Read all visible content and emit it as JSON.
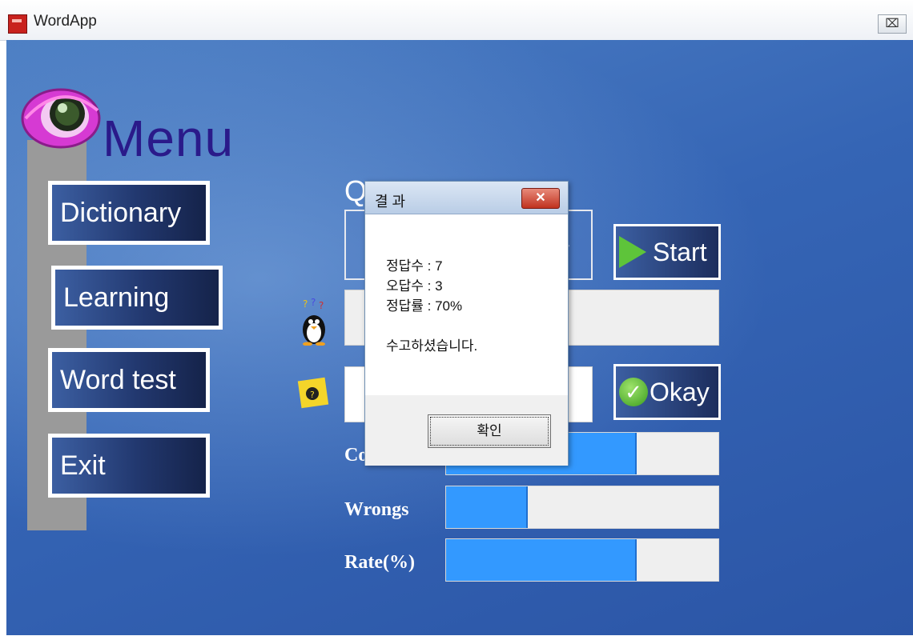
{
  "window": {
    "title": "WordApp",
    "close_glyph": "⌧"
  },
  "menu": {
    "title": "Menu",
    "items": [
      {
        "label": "Dictionary"
      },
      {
        "label": "Learning"
      },
      {
        "label": "Word test"
      },
      {
        "label": "Exit"
      }
    ]
  },
  "quiz": {
    "letter": "Q",
    "word_partial": "y",
    "start_label": "Start",
    "okay_label": "Okay"
  },
  "stats": [
    {
      "label": "Co",
      "fill": 0.7
    },
    {
      "label": "Wrongs",
      "fill": 0.3
    },
    {
      "label": "Rate(%)",
      "fill": 0.7
    }
  ],
  "dialog": {
    "title": "결 과",
    "close_glyph": "✕",
    "lines": [
      "정답수 : 7",
      "오답수 : 3",
      "정답률 : 70%",
      "수고하셨습니다."
    ],
    "ok_label": "확인"
  },
  "colors": {
    "accent_fill": "#3399ff",
    "menu_title": "#2a1a8a"
  }
}
